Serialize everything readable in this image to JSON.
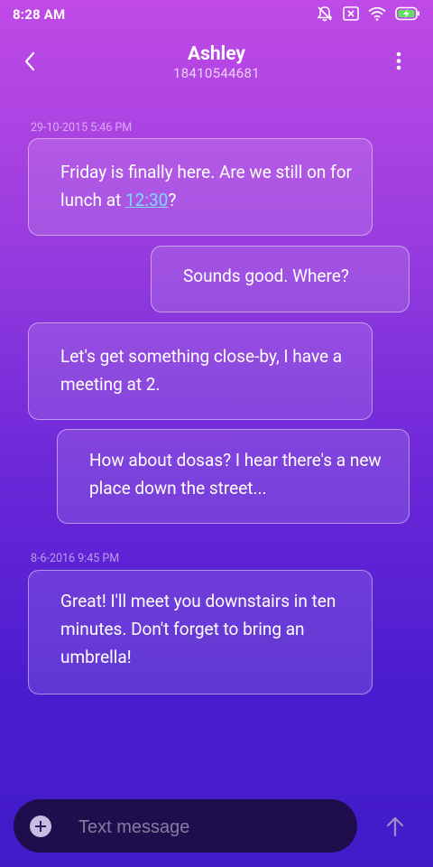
{
  "status_bar": {
    "time": "8:28 AM",
    "icons": [
      "notifications-off-icon",
      "sim-off-icon",
      "wifi-icon",
      "battery-charging-icon"
    ]
  },
  "header": {
    "contact_name": "Ashley",
    "contact_number": "18410544681"
  },
  "conversation": {
    "timestamps": [
      "29-10-2015 5:46 PM",
      "8-6-2016 9:45 PM"
    ],
    "messages": [
      {
        "direction": "received",
        "text_before": "Friday is finally here. Are we still on for lunch at ",
        "link": "12:30",
        "text_after": "?"
      },
      {
        "direction": "sent",
        "text": "Sounds good. Where?"
      },
      {
        "direction": "received",
        "text": "Let's get something close-by, I have a meeting at 2."
      },
      {
        "direction": "sent",
        "text": "How about dosas? I hear there's a new place down the street..."
      },
      {
        "direction": "received",
        "text": "Great! I'll meet you downstairs in ten minutes. Don't forget to bring an umbrella!"
      }
    ]
  },
  "composer": {
    "placeholder": "Text message",
    "value": ""
  },
  "colors": {
    "gradient_top": "#c04ae6",
    "gradient_bottom": "#421bc9",
    "link": "#7fd8ff",
    "composer_bg": "#1f0e4d"
  }
}
